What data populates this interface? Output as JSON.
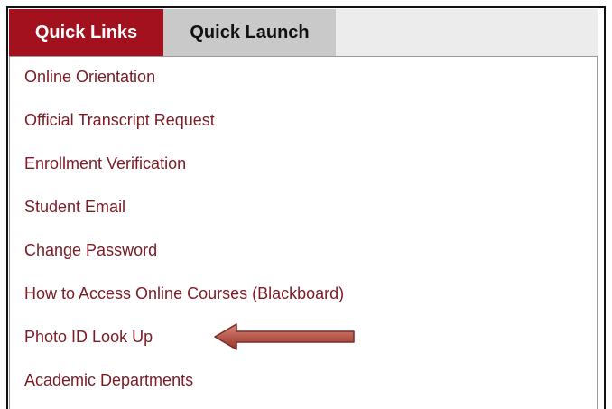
{
  "tabs": {
    "quick_links": "Quick Links",
    "quick_launch": "Quick Launch"
  },
  "links": [
    "Online Orientation",
    "Official Transcript Request",
    "Enrollment Verification",
    "Student Email",
    "Change Password",
    "How to Access Online Courses (Blackboard)",
    "Photo ID Look Up",
    "Academic Departments"
  ],
  "annotation": {
    "arrow_icon": "left-arrow-icon",
    "arrow_color": "#b85a4e",
    "points_to_index": 6
  },
  "colors": {
    "active_tab": "#a3111f",
    "inactive_tab": "#c9c9c9",
    "link_text": "#7e1a24"
  }
}
